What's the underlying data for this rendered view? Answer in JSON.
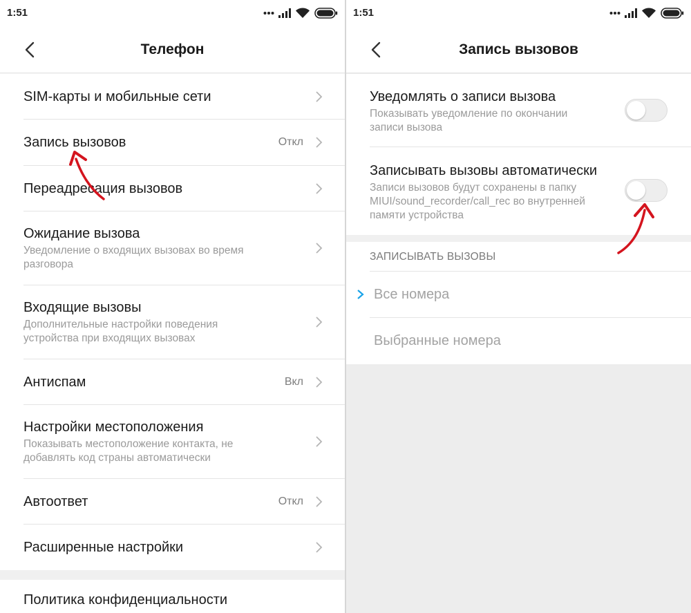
{
  "left": {
    "status_time": "1:51",
    "title": "Телефон",
    "items": [
      {
        "title": "SIM-карты и мобильные сети",
        "subtitle": "",
        "value": ""
      },
      {
        "title": "Запись вызовов",
        "subtitle": "",
        "value": "Откл"
      },
      {
        "title": "Переадресация вызовов",
        "subtitle": "",
        "value": ""
      },
      {
        "title": "Ожидание вызова",
        "subtitle": "Уведомление о входящих вызовах во время разговора",
        "value": ""
      },
      {
        "title": "Входящие вызовы",
        "subtitle": "Дополнительные настройки поведения устройства при входящих вызовах",
        "value": ""
      },
      {
        "title": "Антиспам",
        "subtitle": "",
        "value": "Вкл"
      },
      {
        "title": "Настройки местоположения",
        "subtitle": "Показывать местоположение контакта, не добавлять код страны автоматически",
        "value": ""
      },
      {
        "title": "Автоответ",
        "subtitle": "",
        "value": "Откл"
      },
      {
        "title": "Расширенные настройки",
        "subtitle": "",
        "value": ""
      }
    ],
    "privacy": "Политика конфиденциальности"
  },
  "right": {
    "status_time": "1:51",
    "title": "Запись вызовов",
    "notify": {
      "title": "Уведомлять о записи вызова",
      "subtitle": "Показывать уведомление по окончании записи вызова",
      "enabled": false
    },
    "auto": {
      "title": "Записывать вызовы автоматически",
      "subtitle": "Записи вызовов будут сохранены в папку MIUI/sound_recorder/call_rec во внутренней памяти устройства",
      "enabled": false
    },
    "section_header": "ЗАПИСЫВАТЬ ВЫЗОВЫ",
    "options": [
      {
        "label": "Все номера",
        "selected": true
      },
      {
        "label": "Выбранные номера",
        "selected": false
      }
    ]
  },
  "colors": {
    "accent": "#1aa3e8",
    "annotation_arrow": "#d4141e"
  },
  "icons": {
    "status": [
      "dots-icon",
      "signal-icon",
      "wifi-icon",
      "battery-icon"
    ],
    "back": "back-arrow-icon",
    "chevron": "chevron-right-icon",
    "check": "check-icon"
  }
}
